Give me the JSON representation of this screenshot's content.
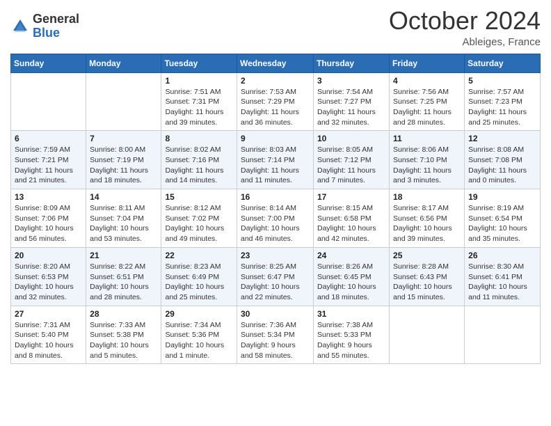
{
  "header": {
    "logo_general": "General",
    "logo_blue": "Blue",
    "month_title": "October 2024",
    "location": "Ableiges, France"
  },
  "weekdays": [
    "Sunday",
    "Monday",
    "Tuesday",
    "Wednesday",
    "Thursday",
    "Friday",
    "Saturday"
  ],
  "weeks": [
    [
      null,
      null,
      {
        "day": "1",
        "sunrise": "Sunrise: 7:51 AM",
        "sunset": "Sunset: 7:31 PM",
        "daylight": "Daylight: 11 hours and 39 minutes."
      },
      {
        "day": "2",
        "sunrise": "Sunrise: 7:53 AM",
        "sunset": "Sunset: 7:29 PM",
        "daylight": "Daylight: 11 hours and 36 minutes."
      },
      {
        "day": "3",
        "sunrise": "Sunrise: 7:54 AM",
        "sunset": "Sunset: 7:27 PM",
        "daylight": "Daylight: 11 hours and 32 minutes."
      },
      {
        "day": "4",
        "sunrise": "Sunrise: 7:56 AM",
        "sunset": "Sunset: 7:25 PM",
        "daylight": "Daylight: 11 hours and 28 minutes."
      },
      {
        "day": "5",
        "sunrise": "Sunrise: 7:57 AM",
        "sunset": "Sunset: 7:23 PM",
        "daylight": "Daylight: 11 hours and 25 minutes."
      }
    ],
    [
      {
        "day": "6",
        "sunrise": "Sunrise: 7:59 AM",
        "sunset": "Sunset: 7:21 PM",
        "daylight": "Daylight: 11 hours and 21 minutes."
      },
      {
        "day": "7",
        "sunrise": "Sunrise: 8:00 AM",
        "sunset": "Sunset: 7:19 PM",
        "daylight": "Daylight: 11 hours and 18 minutes."
      },
      {
        "day": "8",
        "sunrise": "Sunrise: 8:02 AM",
        "sunset": "Sunset: 7:16 PM",
        "daylight": "Daylight: 11 hours and 14 minutes."
      },
      {
        "day": "9",
        "sunrise": "Sunrise: 8:03 AM",
        "sunset": "Sunset: 7:14 PM",
        "daylight": "Daylight: 11 hours and 11 minutes."
      },
      {
        "day": "10",
        "sunrise": "Sunrise: 8:05 AM",
        "sunset": "Sunset: 7:12 PM",
        "daylight": "Daylight: 11 hours and 7 minutes."
      },
      {
        "day": "11",
        "sunrise": "Sunrise: 8:06 AM",
        "sunset": "Sunset: 7:10 PM",
        "daylight": "Daylight: 11 hours and 3 minutes."
      },
      {
        "day": "12",
        "sunrise": "Sunrise: 8:08 AM",
        "sunset": "Sunset: 7:08 PM",
        "daylight": "Daylight: 11 hours and 0 minutes."
      }
    ],
    [
      {
        "day": "13",
        "sunrise": "Sunrise: 8:09 AM",
        "sunset": "Sunset: 7:06 PM",
        "daylight": "Daylight: 10 hours and 56 minutes."
      },
      {
        "day": "14",
        "sunrise": "Sunrise: 8:11 AM",
        "sunset": "Sunset: 7:04 PM",
        "daylight": "Daylight: 10 hours and 53 minutes."
      },
      {
        "day": "15",
        "sunrise": "Sunrise: 8:12 AM",
        "sunset": "Sunset: 7:02 PM",
        "daylight": "Daylight: 10 hours and 49 minutes."
      },
      {
        "day": "16",
        "sunrise": "Sunrise: 8:14 AM",
        "sunset": "Sunset: 7:00 PM",
        "daylight": "Daylight: 10 hours and 46 minutes."
      },
      {
        "day": "17",
        "sunrise": "Sunrise: 8:15 AM",
        "sunset": "Sunset: 6:58 PM",
        "daylight": "Daylight: 10 hours and 42 minutes."
      },
      {
        "day": "18",
        "sunrise": "Sunrise: 8:17 AM",
        "sunset": "Sunset: 6:56 PM",
        "daylight": "Daylight: 10 hours and 39 minutes."
      },
      {
        "day": "19",
        "sunrise": "Sunrise: 8:19 AM",
        "sunset": "Sunset: 6:54 PM",
        "daylight": "Daylight: 10 hours and 35 minutes."
      }
    ],
    [
      {
        "day": "20",
        "sunrise": "Sunrise: 8:20 AM",
        "sunset": "Sunset: 6:53 PM",
        "daylight": "Daylight: 10 hours and 32 minutes."
      },
      {
        "day": "21",
        "sunrise": "Sunrise: 8:22 AM",
        "sunset": "Sunset: 6:51 PM",
        "daylight": "Daylight: 10 hours and 28 minutes."
      },
      {
        "day": "22",
        "sunrise": "Sunrise: 8:23 AM",
        "sunset": "Sunset: 6:49 PM",
        "daylight": "Daylight: 10 hours and 25 minutes."
      },
      {
        "day": "23",
        "sunrise": "Sunrise: 8:25 AM",
        "sunset": "Sunset: 6:47 PM",
        "daylight": "Daylight: 10 hours and 22 minutes."
      },
      {
        "day": "24",
        "sunrise": "Sunrise: 8:26 AM",
        "sunset": "Sunset: 6:45 PM",
        "daylight": "Daylight: 10 hours and 18 minutes."
      },
      {
        "day": "25",
        "sunrise": "Sunrise: 8:28 AM",
        "sunset": "Sunset: 6:43 PM",
        "daylight": "Daylight: 10 hours and 15 minutes."
      },
      {
        "day": "26",
        "sunrise": "Sunrise: 8:30 AM",
        "sunset": "Sunset: 6:41 PM",
        "daylight": "Daylight: 10 hours and 11 minutes."
      }
    ],
    [
      {
        "day": "27",
        "sunrise": "Sunrise: 7:31 AM",
        "sunset": "Sunset: 5:40 PM",
        "daylight": "Daylight: 10 hours and 8 minutes."
      },
      {
        "day": "28",
        "sunrise": "Sunrise: 7:33 AM",
        "sunset": "Sunset: 5:38 PM",
        "daylight": "Daylight: 10 hours and 5 minutes."
      },
      {
        "day": "29",
        "sunrise": "Sunrise: 7:34 AM",
        "sunset": "Sunset: 5:36 PM",
        "daylight": "Daylight: 10 hours and 1 minute."
      },
      {
        "day": "30",
        "sunrise": "Sunrise: 7:36 AM",
        "sunset": "Sunset: 5:34 PM",
        "daylight": "Daylight: 9 hours and 58 minutes."
      },
      {
        "day": "31",
        "sunrise": "Sunrise: 7:38 AM",
        "sunset": "Sunset: 5:33 PM",
        "daylight": "Daylight: 9 hours and 55 minutes."
      },
      null,
      null
    ]
  ]
}
